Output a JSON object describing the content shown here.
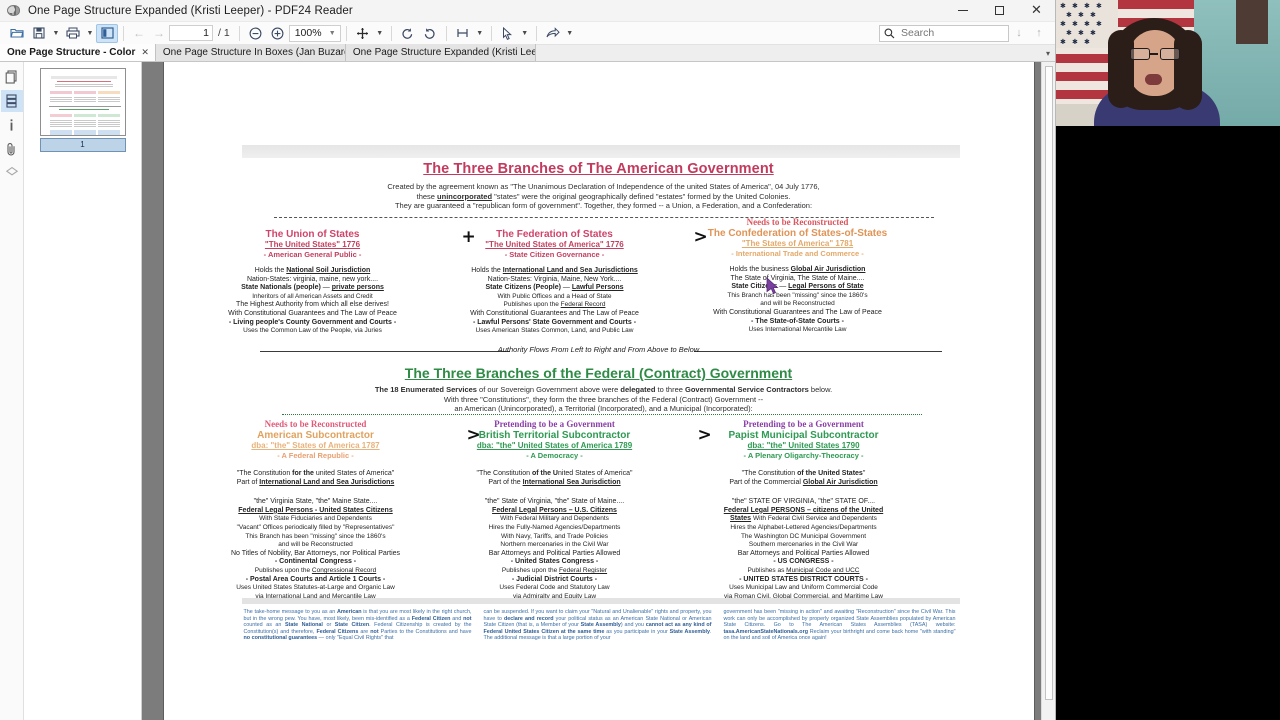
{
  "window": {
    "title": "One Page Structure Expanded (Kristi Leeper) - PDF24 Reader",
    "app_icon": "bee-icon",
    "minimize_label": "–",
    "maximize_label": "□",
    "close_label": "✕"
  },
  "toolbar": {
    "open_icon": "open-folder-icon",
    "save_icon": "save-icon",
    "print_icon": "print-icon",
    "sidebar_toggle_icon": "sidebar-panel-icon",
    "prev_page_icon": "arrow-left-icon",
    "next_page_icon": "arrow-right-icon",
    "page_number": "1",
    "page_total": "/ 1",
    "zoom_out_icon": "zoom-out-icon",
    "zoom_in_icon": "zoom-in-icon",
    "zoom_value": "100%",
    "pan_icon": "move-hand-icon",
    "rotate_left_icon": "rotate-left-icon",
    "rotate_right_icon": "rotate-right-icon",
    "fit_icon": "fit-width-icon",
    "select_icon": "cursor-select-icon",
    "share_icon": "share-icon",
    "search_placeholder": "Search",
    "search_value": "",
    "search_icon": "search-icon",
    "search_next_icon": "arrow-down-icon",
    "search_prev_icon": "arrow-up-icon"
  },
  "tabs": [
    {
      "label": "One Page Structure - Color",
      "active": true,
      "close": "✕"
    },
    {
      "label": "One Page Structure In Boxes (Jan Buzard)",
      "active": false,
      "close": "✕"
    },
    {
      "label": "One Page Structure Expanded (Kristi Leep...",
      "active": false,
      "close": "✕"
    }
  ],
  "tabstrip": {
    "overflow_caret": "▾"
  },
  "rail": [
    {
      "name": "pages-icon",
      "label": "Pages"
    },
    {
      "name": "thumbnails-icon",
      "label": "Thumbnails",
      "active": true
    },
    {
      "name": "info-icon",
      "label": "Document Info"
    },
    {
      "name": "attachments-icon",
      "label": "Attachments"
    },
    {
      "name": "layers-icon",
      "label": "Layers"
    }
  ],
  "thumbnails": {
    "page_label": "1"
  },
  "document": {
    "section1": {
      "title": "The Three Branches of The American Government",
      "intro": [
        "Created by the agreement known as \"The Unanimous Declaration of Independence of the united States of America\", 04 July 1776,",
        "these unincorporated \"states\" were the original geographically defined \"estates\" formed by the United Colonies.",
        "They are guaranteed a \"republican form of government\".  Together, they formed -- a Union, a Federation, and a Confederation:"
      ],
      "operators": [
        "+",
        ">"
      ],
      "columns": [
        {
          "heading1": "The Union of States",
          "heading2": "\"The United States\"  1776",
          "heading3": "- American General Public -",
          "pre_heading": "",
          "body": [
            "Holds the National Soil Jurisdiction",
            "Nation-States: virginia, maine, new york....",
            "State Nationals (people) — private persons",
            "Inheritors of all American Assets and Credit",
            "The Highest Authority from which all else derives!",
            "With Constitutional Guarantees and The Law of Peace",
            "- Living people's County Government and Courts -",
            "Uses the Common Law of the People, via Juries"
          ]
        },
        {
          "heading1": "The Federation of States",
          "heading2": "\"The United States of America\"  1776",
          "heading3": "- State Citizen Governance -",
          "pre_heading": "",
          "body": [
            "Holds the International Land and Sea Jurisdictions",
            "Nation-States: Virginia, Maine, New York....",
            "State Citizens (People) — Lawful Persons",
            "With Public Offices and a Head of State",
            "Publishes upon the Federal Record",
            "With Constitutional Guarantees and The Law of Peace",
            "- Lawful Persons' State Government and Courts -",
            "Uses American States Common, Land, and Public Law"
          ]
        },
        {
          "heading1": "The Confederation of States-of-States",
          "heading2": "\"The States of America\"  1781",
          "heading3": "- International Trade and Commerce -",
          "pre_heading": "Needs to be Reconstructed",
          "body": [
            "Holds the business Global Air Jurisdiction",
            "The State of Virginia, The State of Maine....",
            "State Citizens — Legal Persons of State",
            "This Branch has been \"missing\" since the 1860's",
            "and will be Reconstructed",
            "With Constitutional Guarantees and The Law of Peace",
            "- The State-of-State Courts -",
            "Uses International Mercantile Law"
          ]
        }
      ]
    },
    "flow_note": "Authority Flows From Left to Right and From Above to Below",
    "section2": {
      "title": "The Three Branches of the Federal (Contract) Government",
      "intro": [
        "The 18 Enumerated Services of our Sovereign Government above were delegated to three Governmental Service Contractors below.",
        "With three \"Constitutions\", they form the three branches of the Federal (Contract) Government --",
        "an American (Unincorporated), a Territorial (Incorporated), and a Municipal (Incorporated):"
      ],
      "operators": [
        ">",
        ">"
      ],
      "columns": [
        {
          "pre_heading": "Needs to be Reconstructed",
          "heading1": "American Subcontractor",
          "heading2": "dba: \"the\" States of America  1787",
          "heading3": "- A Federal Republic -",
          "constitution": [
            "\"The Constitution for the united States of America\"",
            "Part of International Land and Sea Jurisdictions"
          ],
          "body": [
            "\"the\" Virginia State, \"the\" Maine State....",
            "Federal Legal Persons - United States Citizens",
            "With State Fiduciaries and Dependents",
            "\"Vacant\" Offices periodically filled by \"Representatives\"",
            "This Branch has been \"missing\" since the 1860's",
            "and will be Reconstructed",
            "No Titles of Nobility, Bar Attorneys, nor Political Parties",
            "- Continental Congress -",
            "Publishes upon the Congressional Record",
            "- Postal Area Courts and Article 1 Courts -",
            "Uses United States Statutes-at-Large and Organic Law",
            "via International Land and Mercantile Law"
          ]
        },
        {
          "pre_heading": "Pretending to be a Government",
          "heading1": "British Territorial Subcontractor",
          "heading2": "dba: \"the\" United States of America  1789",
          "heading3": "- A Democracy -",
          "constitution": [
            "\"The Constitution of the United States of America\"",
            "Part of the International Sea Jurisdiction"
          ],
          "body": [
            "\"the\" State of Virginia, \"the\" State of Maine....",
            "Federal Legal Persons – U.S. Citizens",
            "With Federal Military and Dependents",
            "Hires the Fully-Named Agencies/Departments",
            "With Navy, Tariffs, and Trade Policies",
            "Northern mercenaries in the Civil War",
            "Bar Attorneys and Political Parties Allowed",
            "- United States Congress -",
            "Publishes upon the Federal Register",
            "- Judicial District Courts -",
            "Uses Federal Code and Statutory Law",
            "via Admiralty and Equity Law"
          ]
        },
        {
          "pre_heading": "Pretending to be a Government",
          "heading1": "Papist Municipal Subcontractor",
          "heading2": "dba: \"the\" United States  1790",
          "heading3": "- A Plenary Oligarchy-Theocracy -",
          "constitution": [
            "\"The Constitution of the United States\"",
            "Part of the Commercial Global Air Jurisdiction"
          ],
          "body": [
            "\"the\" STATE OF VIRGINIA, \"the\" STATE OF....",
            "Federal Legal PERSONS – citizens of the United States",
            "With Federal Civil Service and Dependents",
            "Hires the Alphabet-Lettered Agencies/Departments",
            "The Washington DC Municipal Government",
            "Southern mercenaries in the Civil War",
            "Bar Attorneys and Political Parties Allowed",
            "- US CONGRESS -",
            "Publishes as Municipal Code and UCC",
            "- UNITED STATES DISTRICT COURTS -",
            "Uses Municipal Law and Uniform Commercial Code",
            "via Roman Civil, Global Commercial, and Maritime Law"
          ]
        }
      ]
    },
    "footer_columns": [
      "The take-home message to you as an American is that you are most likely in the right church, but in the wrong pew. You have, most likely, been mis-identified as a Federal Citizen and not counted as an State National or State Citizen. Federal Citizenship is created by the Constitution(s) and therefore, Federal Citizens are not Parties to the Constitutions and have no constitutional guarantees -- only \"Equal Civil Rights\" that",
      "can be suspended. If you want to claim your \"Natural and Unalienable\" rights and property, you have to declare and record your political status as an American State National or American State Citizen (that is, a Member of your State Assembly) and you cannot act as any kind of Federal United States Citizen at the same time as you participate in your State Assembly. The additional message is that a large portion of your",
      "government has been \"missing in action\" and awaiting \"Reconstruction\" since the Civil War. This work can only be accomplished by properly organized State Assemblies populated by American State Citizens. Go to The American States Assemblies (TASA) website: tasa.AmericanStateNationals.org Reclaim your birthright and come back home \"with standing\" on the land and soil of America once again!"
    ]
  },
  "colors": {
    "section1_title": "#c23b5e",
    "section2_title": "#2e8b45",
    "reconstructed_red": "#d9575f",
    "confederation_orange": "#e8a15e",
    "pretending_purple": "#8b3fa8",
    "green_heading": "#2e8b45",
    "footer_blue": "#3b6ea5",
    "accent_tab_active": "#fdfdfd"
  },
  "webcam": {
    "description": "presenter-video-overlay"
  }
}
